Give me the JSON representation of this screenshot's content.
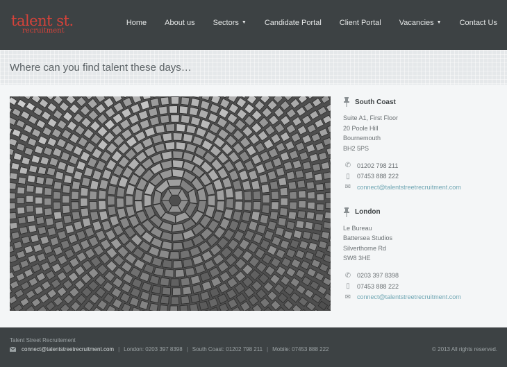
{
  "logo": {
    "main": "talent st.",
    "sub": "recruitment"
  },
  "nav": {
    "items": [
      {
        "label": "Home",
        "dropdown": false
      },
      {
        "label": "About us",
        "dropdown": false
      },
      {
        "label": "Sectors",
        "dropdown": true
      },
      {
        "label": "Candidate Portal",
        "dropdown": false
      },
      {
        "label": "Client Portal",
        "dropdown": false
      },
      {
        "label": "Vacancies",
        "dropdown": true
      },
      {
        "label": "Contact Us",
        "dropdown": false
      }
    ]
  },
  "page": {
    "title": "Where can you find talent these days…"
  },
  "locations": [
    {
      "name": "South Coast",
      "address": [
        "Suite A1, First Floor",
        "20 Poole Hill",
        "Bournemouth",
        "BH2 5PS"
      ],
      "phone": "01202 798 211",
      "mobile": "07453 888 222",
      "email": "connect@talentstreetrecruitment.com"
    },
    {
      "name": "London",
      "address": [
        "Le Bureau",
        "Battersea Studios",
        "Silverthorne Rd",
        "SW8 3HE"
      ],
      "phone": "0203 397 8398",
      "mobile": "07453 888 222",
      "email": "connect@talentstreetrecruitment.com"
    }
  ],
  "footer": {
    "company": "Talent Street Recruitement",
    "email": "connect@talentstreetrecruitment.com",
    "london": "London: 0203 397 8398",
    "south_coast": "South Coast: 01202 798 211",
    "mobile": "Mobile: 07453 888 222",
    "copyright": "© 2013 All rights reserved."
  },
  "colors": {
    "header_bg": "#3d4244",
    "brand_red": "#d6423a",
    "link": "#6fa6b3"
  },
  "icons": [
    "pushpin-icon",
    "phone-icon",
    "mobile-icon",
    "envelope-icon",
    "caret-down-icon"
  ]
}
